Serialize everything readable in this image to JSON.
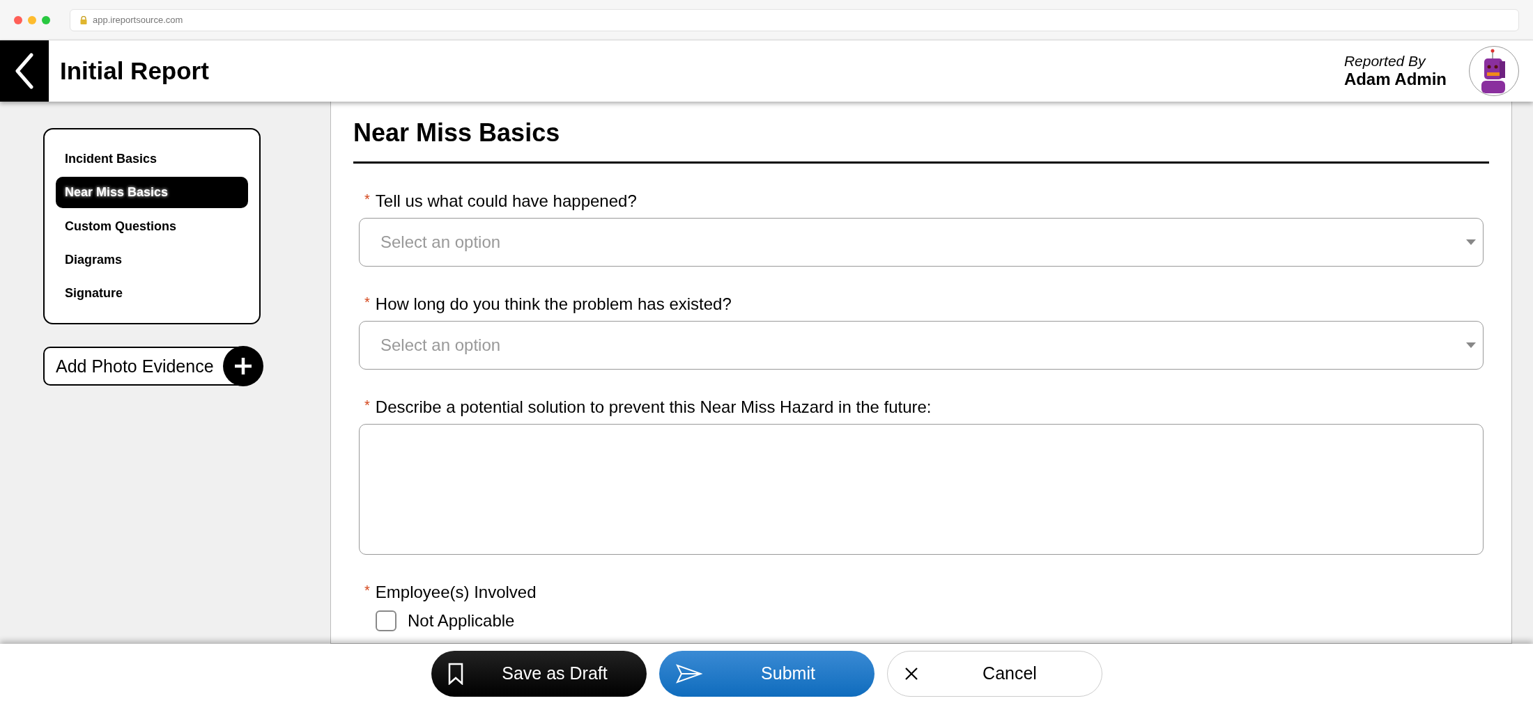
{
  "browser": {
    "url": "app.ireportsource.com"
  },
  "header": {
    "title": "Initial Report",
    "reported_by_label": "Reported By",
    "reporter": "Adam Admin"
  },
  "sidebar": {
    "items": [
      {
        "label": "Incident Basics",
        "selected": false
      },
      {
        "label": "Near Miss Basics",
        "selected": true
      },
      {
        "label": "Custom Questions",
        "selected": false
      },
      {
        "label": "Diagrams",
        "selected": false
      },
      {
        "label": "Signature",
        "selected": false
      }
    ],
    "add_photo": {
      "label": "Add Photo Evidence"
    }
  },
  "form": {
    "title": "Near Miss Basics",
    "questions": [
      {
        "kind": "select",
        "required_mark": "*",
        "label": "Tell us what could have happened?",
        "placeholder": "Select an option"
      },
      {
        "kind": "select",
        "required_mark": "*",
        "label": "How long do you think the problem has existed?",
        "placeholder": "Select an option"
      },
      {
        "kind": "textarea",
        "required_mark": "*",
        "label": "Describe a potential solution to prevent this Near Miss Hazard in the future:"
      },
      {
        "kind": "checkboxes",
        "required_mark": "*",
        "label": "Employee(s) Involved",
        "options": [
          {
            "label": "Not Applicable",
            "checked": false
          }
        ]
      }
    ]
  },
  "footer": {
    "buttons": [
      {
        "kind": "draft",
        "label": "Save as Draft"
      },
      {
        "kind": "submit",
        "label": "Submit"
      },
      {
        "kind": "cancel",
        "label": "Cancel"
      }
    ]
  }
}
